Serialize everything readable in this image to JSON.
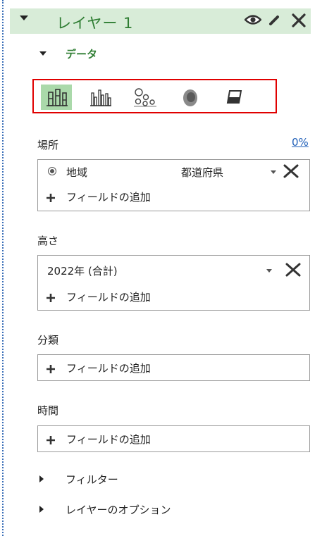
{
  "layer": {
    "name": "レイヤー 1"
  },
  "data_section": {
    "label": "データ"
  },
  "chart_types": [
    {
      "name": "stacked-column",
      "selected": true
    },
    {
      "name": "clustered-column",
      "selected": false
    },
    {
      "name": "bubble",
      "selected": false
    },
    {
      "name": "heat-map",
      "selected": false
    },
    {
      "name": "region",
      "selected": false
    }
  ],
  "location": {
    "label": "場所",
    "percent": "0%",
    "field": "地域",
    "value": "都道府県",
    "add_field": "フィールドの追加"
  },
  "height": {
    "label": "高さ",
    "value": "2022年 (合計)",
    "add_field": "フィールドの追加"
  },
  "category": {
    "label": "分類",
    "add_field": "フィールドの追加"
  },
  "time": {
    "label": "時間",
    "add_field": "フィールドの追加"
  },
  "filter": {
    "label": "フィルター"
  },
  "layer_options": {
    "label": "レイヤーのオプション"
  },
  "colors": {
    "accent_green": "#2e7d32",
    "header_bg": "#d8ecd8",
    "highlight_red": "#e00000",
    "selected_bg": "#aad9aa"
  }
}
